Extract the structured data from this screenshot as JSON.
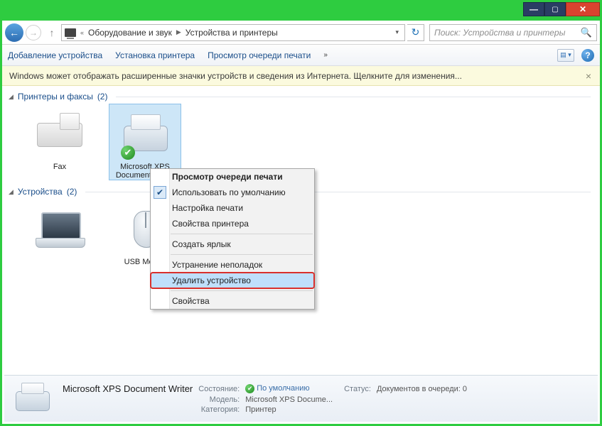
{
  "breadcrumb": {
    "level1": "Оборудование и звук",
    "level2": "Устройства и принтеры"
  },
  "search": {
    "placeholder": "Поиск: Устройства и принтеры"
  },
  "toolbar": {
    "add_device": "Добавление устройства",
    "add_printer": "Установка принтера",
    "view_queue": "Просмотр очереди печати",
    "more": "»"
  },
  "infostrip": {
    "text": "Windows может отображать расширенные значки устройств и сведения из Интернета.  Щелкните для изменения..."
  },
  "groups": {
    "printers": {
      "title": "Принтеры и факсы",
      "count": "(2)"
    },
    "devices": {
      "title": "Устройства",
      "count": "(2)"
    }
  },
  "items": {
    "fax": "Fax",
    "xps_line1": "Microsoft XPS",
    "xps_line2": "Document Writer",
    "laptop": "",
    "mouse": "USB Mouse"
  },
  "context_menu": {
    "view_queue": "Просмотр очереди печати",
    "set_default": "Использовать по умолчанию",
    "print_setup": "Настройка печати",
    "printer_props": "Свойства принтера",
    "create_shortcut": "Создать ярлык",
    "troubleshoot": "Устранение неполадок",
    "remove_device": "Удалить устройство",
    "properties": "Свойства"
  },
  "details": {
    "name": "Microsoft XPS Document Writer",
    "state_label": "Состояние:",
    "state_value": "По умолчанию",
    "model_label": "Модель:",
    "model_value": "Microsoft XPS Docume...",
    "category_label": "Категория:",
    "category_value": "Принтер",
    "status_label": "Статус:",
    "status_value": "Документов в очереди: 0"
  }
}
